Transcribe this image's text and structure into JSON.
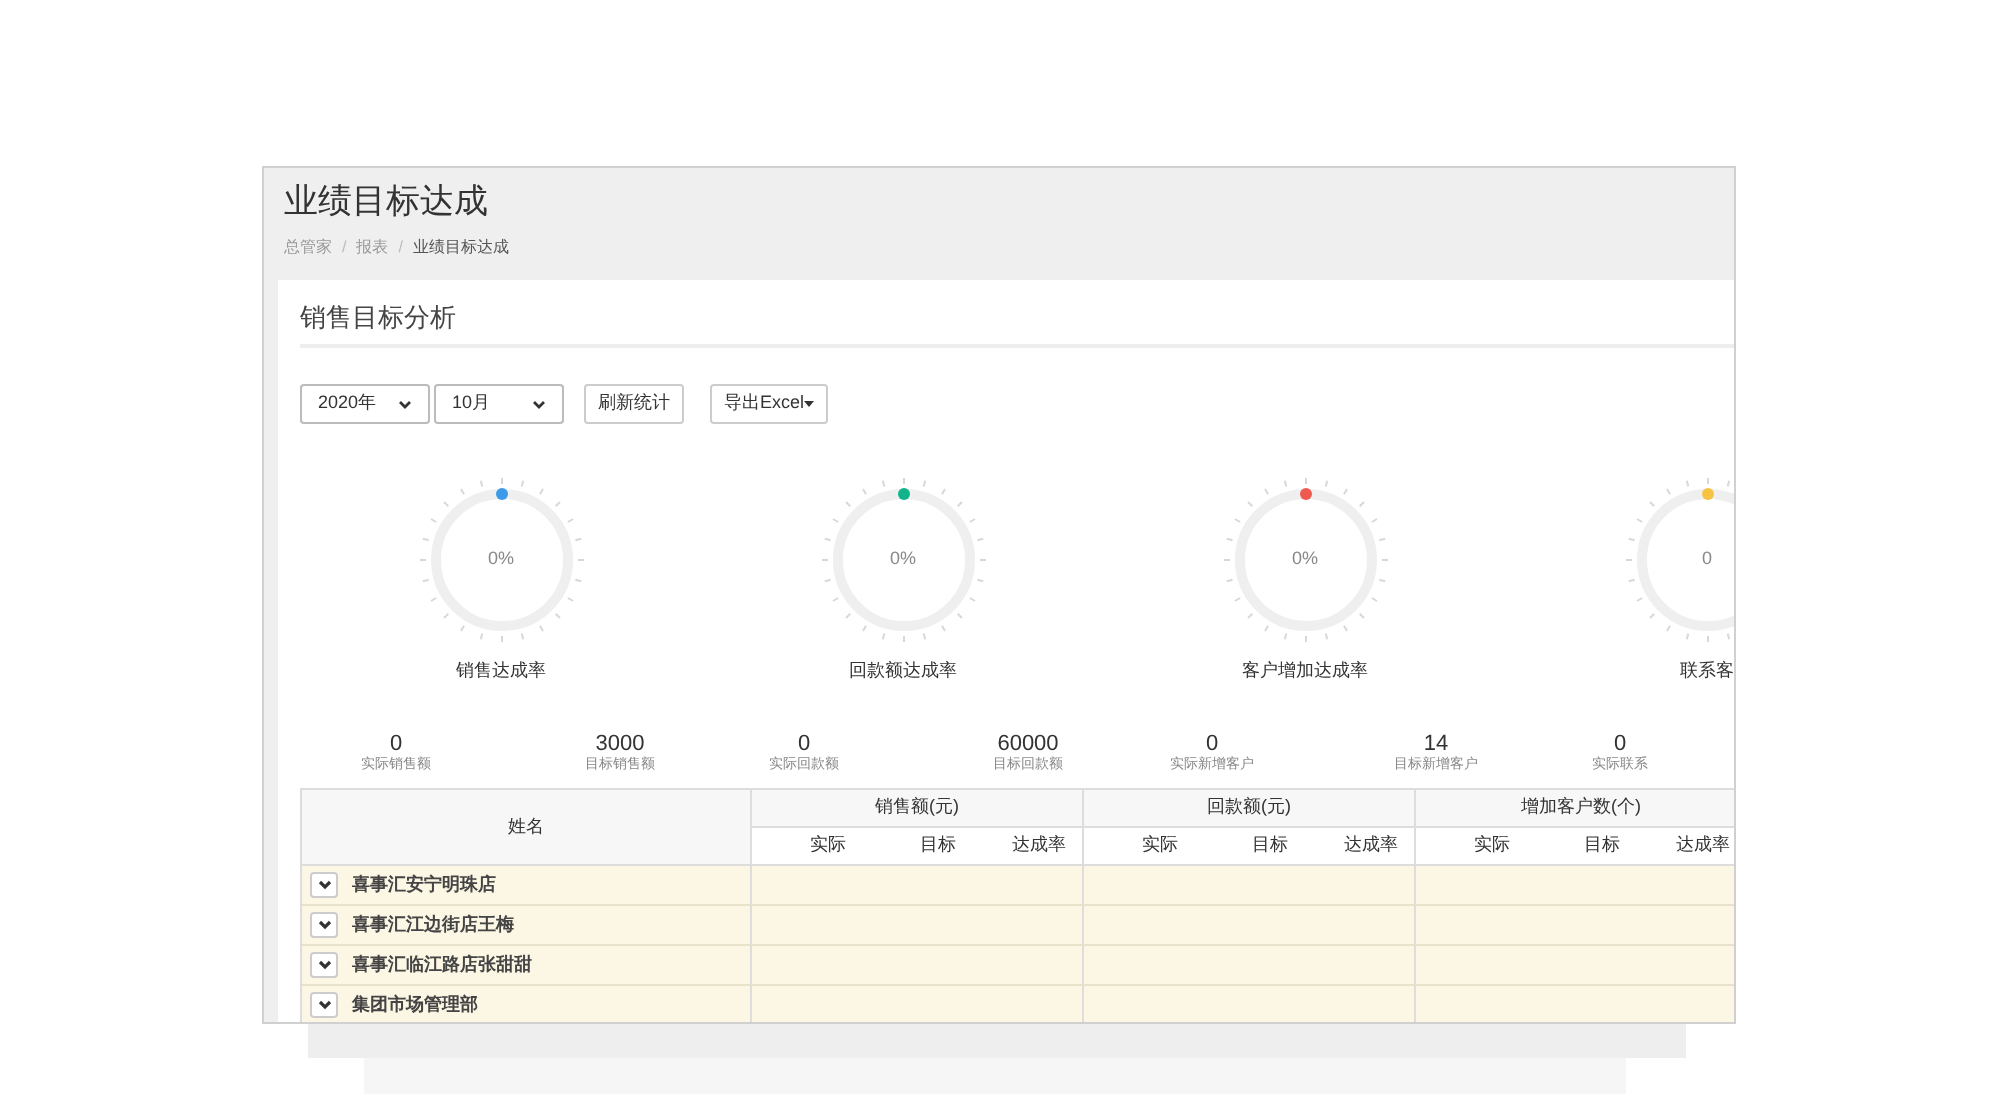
{
  "page": {
    "title": "业绩目标达成",
    "breadcrumb": [
      "总管家",
      "报表",
      "业绩目标达成"
    ],
    "separator": "/"
  },
  "card": {
    "title": "销售目标分析",
    "filters": [
      {
        "value": "2020年"
      },
      {
        "value": "10月"
      }
    ],
    "buttons": [
      {
        "label": "刷新统计",
        "kind": "plain"
      },
      {
        "label": "导出Excel",
        "kind": "dropdown"
      }
    ],
    "gauges": [
      {
        "label": "销售达成率",
        "reading": "0%",
        "color": "#3c9ae8"
      },
      {
        "label": "回款额达成率",
        "reading": "0%",
        "color": "#11b389"
      },
      {
        "label": "客户增加达成率",
        "reading": "0%",
        "color": "#ee5a4f"
      },
      {
        "label": "联系客",
        "reading": "0",
        "color": "#f6c344"
      }
    ],
    "stats": [
      {
        "value": "0",
        "label": "实际销售额"
      },
      {
        "value": "3000",
        "label": "目标销售额"
      },
      {
        "value": "0",
        "label": "实际回款额"
      },
      {
        "value": "60000",
        "label": "目标回款额"
      },
      {
        "value": "0",
        "label": "实际新增客户"
      },
      {
        "value": "14",
        "label": "目标新增客户"
      },
      {
        "value": "0",
        "label": "实际联系"
      }
    ],
    "table": {
      "name_column": "姓名",
      "groups": [
        {
          "title": "销售额(元)",
          "columns": [
            "实际",
            "目标",
            "达成率"
          ]
        },
        {
          "title": "回款额(元)",
          "columns": [
            "实际",
            "目标",
            "达成率"
          ]
        },
        {
          "title": "增加客户数(个)",
          "columns": [
            "实际",
            "目标",
            "达成率"
          ]
        }
      ],
      "rows": [
        {
          "name": "喜事汇安宁明珠店"
        },
        {
          "name": "喜事汇江边街店王梅"
        },
        {
          "name": "喜事汇临江路店张甜甜"
        },
        {
          "name": "集团市场管理部"
        }
      ]
    }
  }
}
